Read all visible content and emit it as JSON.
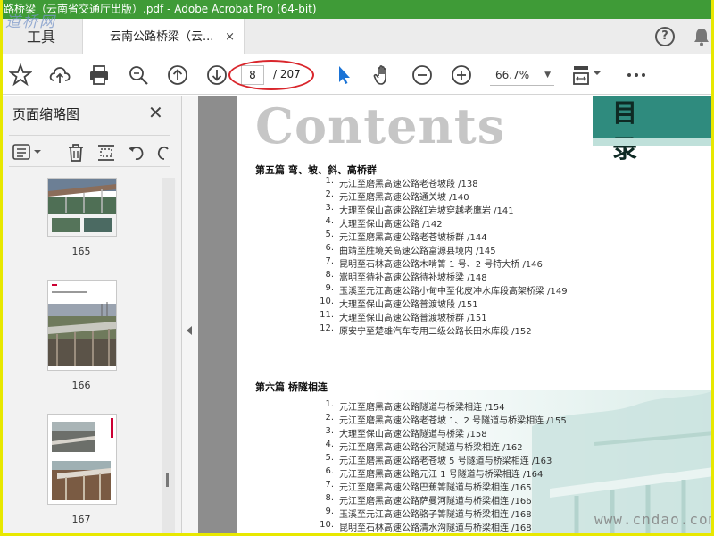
{
  "window": {
    "title": "路桥梁（云南省交通厅出版）.pdf - Adobe Acrobat Pro (64-bit)",
    "watermark": "道桥网"
  },
  "tabs": {
    "tools_label": "工具",
    "document_label": "云南公路桥梁（云...",
    "close_glyph": "×"
  },
  "header_icons": [
    "help-icon",
    "bell-icon"
  ],
  "toolbar": {
    "current_page": "8",
    "total_pages": "/ 207",
    "zoom": "66.7%",
    "icons": [
      "star-icon",
      "upload-icon",
      "print-icon",
      "zoom-search-icon",
      "page-up-icon",
      "page-down-icon",
      "select-cursor-icon",
      "hand-icon",
      "zoom-out-icon",
      "zoom-in-icon",
      "fit-page-icon",
      "more-icon"
    ]
  },
  "sidepanel": {
    "title": "页面缩略图",
    "thumbnails": [
      {
        "label": "165"
      },
      {
        "label": "166"
      },
      {
        "label": "167"
      }
    ]
  },
  "document": {
    "contents_title": "Contents",
    "mulu": "目 录",
    "section5": {
      "title": "第五篇   弯、坡、斜、高桥群",
      "items": [
        {
          "num": "1.",
          "text": "元江至磨黑高速公路老苍坡段 /138"
        },
        {
          "num": "2.",
          "text": "元江至磨黑高速公路通关坡 /140"
        },
        {
          "num": "3.",
          "text": "大理至保山高速公路红岩坡穿越老鹰岩 /141"
        },
        {
          "num": "4.",
          "text": "大理至保山高速公路 /142"
        },
        {
          "num": "5.",
          "text": "元江至磨黑高速公路老苍坡桥群 /144"
        },
        {
          "num": "6.",
          "text": "曲靖至胜境关高速公路富源县境内 /145"
        },
        {
          "num": "7.",
          "text": "昆明至石林高速公路木啃箐 1 号、2 号特大桥 /146"
        },
        {
          "num": "8.",
          "text": "嵩明至待补高速公路待补坡桥梁 /148"
        },
        {
          "num": "9.",
          "text": "玉溪至元江高速公路小甸中至化皮冲水库段高架桥梁 /149"
        },
        {
          "num": "10.",
          "text": "大理至保山高速公路普渡坡段 /151"
        },
        {
          "num": "11.",
          "text": "大理至保山高速公路普渡坡桥群 /151"
        },
        {
          "num": "12.",
          "text": "原安宁至楚雄汽车专用二级公路长田水库段 /152"
        }
      ]
    },
    "section6": {
      "title": "第六篇   桥隧相连",
      "items": [
        {
          "num": "1.",
          "text": "元江至磨黑高速公路隧道与桥梁相连 /154"
        },
        {
          "num": "2.",
          "text": "元江至磨黑高速公路老苍坡 1、2 号隧道与桥梁相连 /155"
        },
        {
          "num": "3.",
          "text": "大理至保山高速公路隧道与桥梁 /158"
        },
        {
          "num": "4.",
          "text": "元江至磨黑高速公路谷河隧道与桥梁相连 /162"
        },
        {
          "num": "5.",
          "text": "元江至磨黑高速公路老苍坡 5 号隧道与桥梁相连 /163"
        },
        {
          "num": "6.",
          "text": "元江至磨黑高速公路元江 1 号隧道与桥梁相连 /164"
        },
        {
          "num": "7.",
          "text": "元江至磨黑高速公路巴蕉箐隧道与桥梁相连 /165"
        },
        {
          "num": "8.",
          "text": "元江至磨黑高速公路萨曼河隧道与桥梁相连 /166"
        },
        {
          "num": "9.",
          "text": "玉溪至元江高速公路骆子箐隧道与桥梁相连 /168"
        },
        {
          "num": "10.",
          "text": "昆明至石林高速公路清水沟隧道与桥梁相连 /168"
        }
      ]
    },
    "watermark_bottom": "www.cndao.com"
  }
}
